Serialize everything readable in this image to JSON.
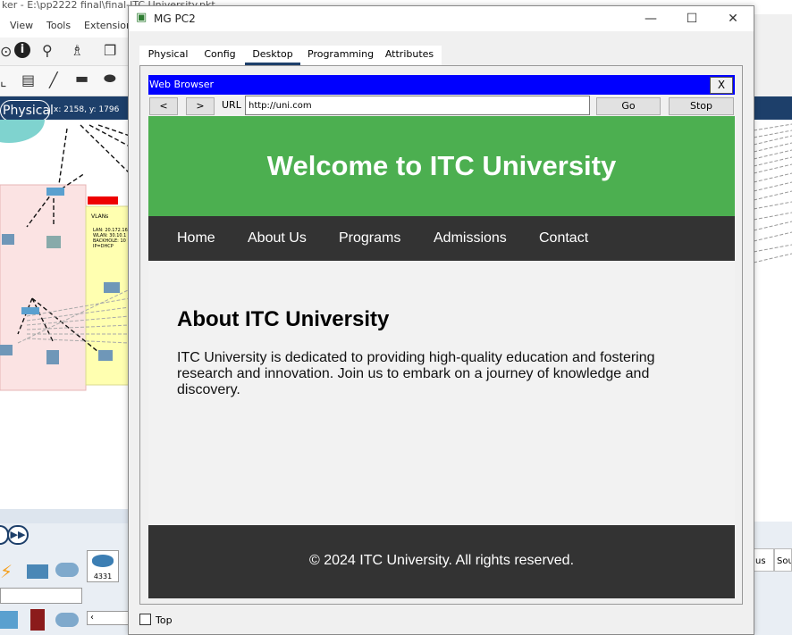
{
  "background_app": {
    "title": "ker - E:\\pp2222 final\\final-ITC University.pkt",
    "menu": [
      "View",
      "Tools",
      "Extensions"
    ],
    "mode_label": "Physical",
    "coords": "x: 2158, y: 1796",
    "device_model": "4331",
    "right_tabs": [
      "us",
      "Sou"
    ]
  },
  "window": {
    "title": "MG PC2",
    "controls": {
      "minimize": "—",
      "maximize": "☐",
      "close": "✕"
    },
    "tabs": [
      "Physical",
      "Config",
      "Desktop",
      "Programming",
      "Attributes"
    ],
    "active_tab": "Desktop",
    "top_checkbox_label": "Top"
  },
  "browser": {
    "title": "Web Browser",
    "close_label": "X",
    "back_label": "<",
    "forward_label": ">",
    "url_label": "URL",
    "url_value": "http://uni.com",
    "go_label": "Go",
    "stop_label": "Stop"
  },
  "webpage": {
    "heading": "Welcome to ITC University",
    "nav": [
      "Home",
      "About Us",
      "Programs",
      "Admissions",
      "Contact"
    ],
    "about_title": "About ITC University",
    "about_text": "ITC University is dedicated to providing high-quality education and fostering research and innovation. Join us to embark on a journey of knowledge and discovery.",
    "footer": "© 2024 ITC University. All rights reserved."
  },
  "colors": {
    "hero_green": "#4caf50",
    "nav_dark": "#333333",
    "browser_title_blue": "#0000ff",
    "app_bar_navy": "#1d3f6a"
  }
}
